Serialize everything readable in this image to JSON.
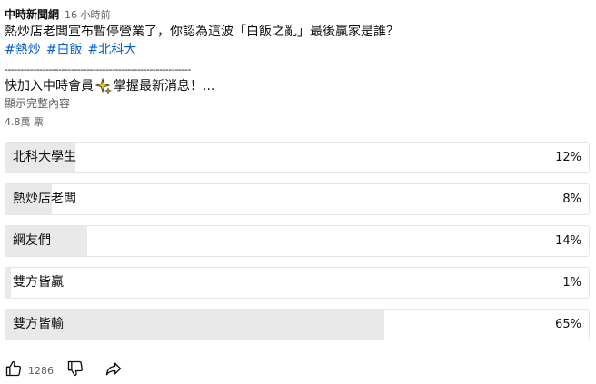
{
  "post": {
    "channel": "中時新聞網",
    "time": "16 小時前",
    "text_line1": "熱炒店老闆宣布暫停營業了，你認為這波「白飯之亂」最後贏家是誰？",
    "hashtags": [
      "#熱炒",
      "#白飯",
      "#北科大"
    ],
    "divider": "-----------------------------------------------------------",
    "text_line3_prefix": "快加入中時會員",
    "text_line3_suffix": "掌握最新消息！...",
    "show_more": "顯示完整內容",
    "votes": "4.8萬 票"
  },
  "poll": {
    "options": [
      {
        "label": "北科大學生",
        "percent": "12%",
        "fill": 12
      },
      {
        "label": "熱炒店老闆",
        "percent": "8%",
        "fill": 8
      },
      {
        "label": "網友們",
        "percent": "14%",
        "fill": 14
      },
      {
        "label": "雙方皆贏",
        "percent": "1%",
        "fill": 1
      },
      {
        "label": "雙方皆輸",
        "percent": "65%",
        "fill": 65
      }
    ]
  },
  "actions": {
    "like_count": "1286",
    "like_icon": "thumb-up-icon",
    "dislike_icon": "thumb-down-icon",
    "share_icon": "share-icon"
  },
  "colors": {
    "hashtag": "#065fd4",
    "poll_fill": "#e9e9e9",
    "poll_border": "#e5e5e5",
    "sparkle": "#f4c20d"
  }
}
